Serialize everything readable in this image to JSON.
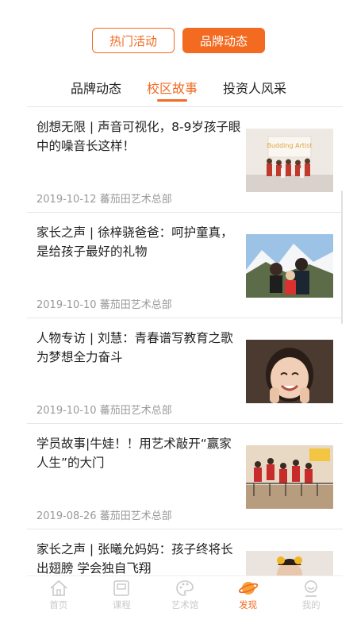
{
  "toggle": {
    "hot_label": "热门活动",
    "brand_label": "品牌动态"
  },
  "tabs": [
    {
      "label": "品牌动态"
    },
    {
      "label": "校区故事"
    },
    {
      "label": "投资人风采"
    }
  ],
  "articles": [
    {
      "title": "创想无限 | 声音可视化，8-9岁孩子眼中的噪音长这样！",
      "date": "2019-10-12",
      "source": "蕃茄田艺术总部",
      "thumb_text": "Budding Artist"
    },
    {
      "title": "家长之声 | 徐梓骁爸爸：呵护童真，是给孩子最好的礼物",
      "date": "2019-10-10",
      "source": "蕃茄田艺术总部"
    },
    {
      "title": "人物专访 | 刘慧：青春谱写教育之歌 为梦想全力奋斗",
      "date": "2019-10-10",
      "source": "蕃茄田艺术总部"
    },
    {
      "title": "学员故事|牛娃！！用艺术敲开“赢家人生”的大门",
      "date": "2019-08-26",
      "source": "蕃茄田艺术总部"
    },
    {
      "title": "家长之声 | 张曦允妈妈：孩子终将长出翅膀 学会独自飞翔",
      "date": "",
      "source": ""
    }
  ],
  "nav": [
    {
      "label": "首页",
      "icon": "home-icon"
    },
    {
      "label": "课程",
      "icon": "course-icon"
    },
    {
      "label": "艺术馆",
      "icon": "palette-icon"
    },
    {
      "label": "发现",
      "icon": "discover-icon"
    },
    {
      "label": "我的",
      "icon": "profile-icon"
    }
  ],
  "colors": {
    "accent": "#f26b21",
    "text": "#222222",
    "meta": "#9a9a9a"
  }
}
